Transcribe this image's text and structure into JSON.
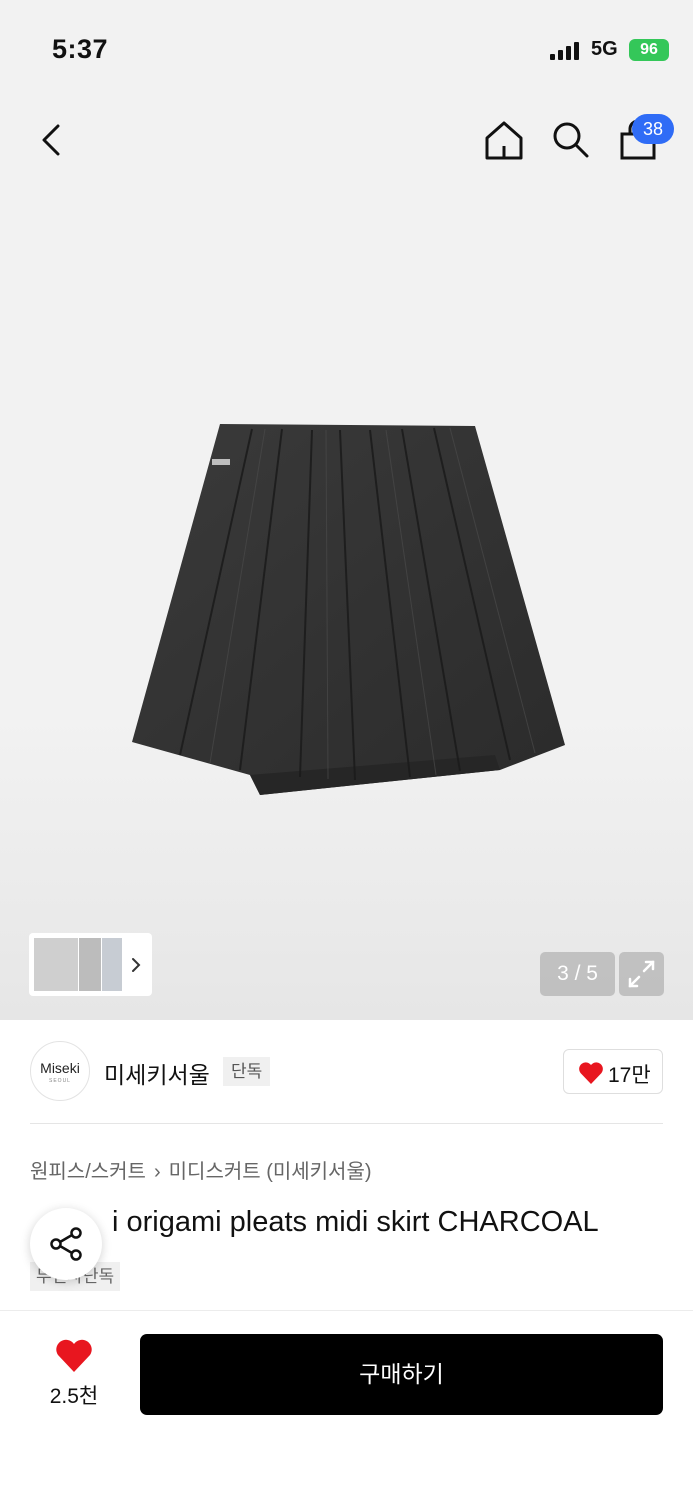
{
  "status_bar": {
    "time": "5:37",
    "network": "5G",
    "battery": "96"
  },
  "nav": {
    "cart_count": "38"
  },
  "gallery": {
    "page_indicator": "3 / 5",
    "current_page": 3,
    "total_pages": 5
  },
  "brand": {
    "logo_text": "Miseki",
    "logo_sub": "SEOUL",
    "name": "미세키서울",
    "tag": "단독",
    "like_count": "17만"
  },
  "breadcrumb": {
    "items": [
      "원피스/스커트",
      "미디스커트 (미세키서울)"
    ]
  },
  "product": {
    "title": "i origami pleats midi skirt CHARCOAL",
    "title_tag": "무신사단독"
  },
  "bottom": {
    "wish_count": "2.5천",
    "buy_label": "구매하기"
  },
  "colors": {
    "accent_blue": "#2f6cf6",
    "heart_red": "#e8161f",
    "battery_green": "#34c759",
    "buy_bg": "#000000"
  },
  "icons": [
    "back-icon",
    "home-icon",
    "search-icon",
    "bag-icon",
    "chevron-right-icon",
    "expand-icon",
    "heart-icon",
    "share-icon"
  ]
}
